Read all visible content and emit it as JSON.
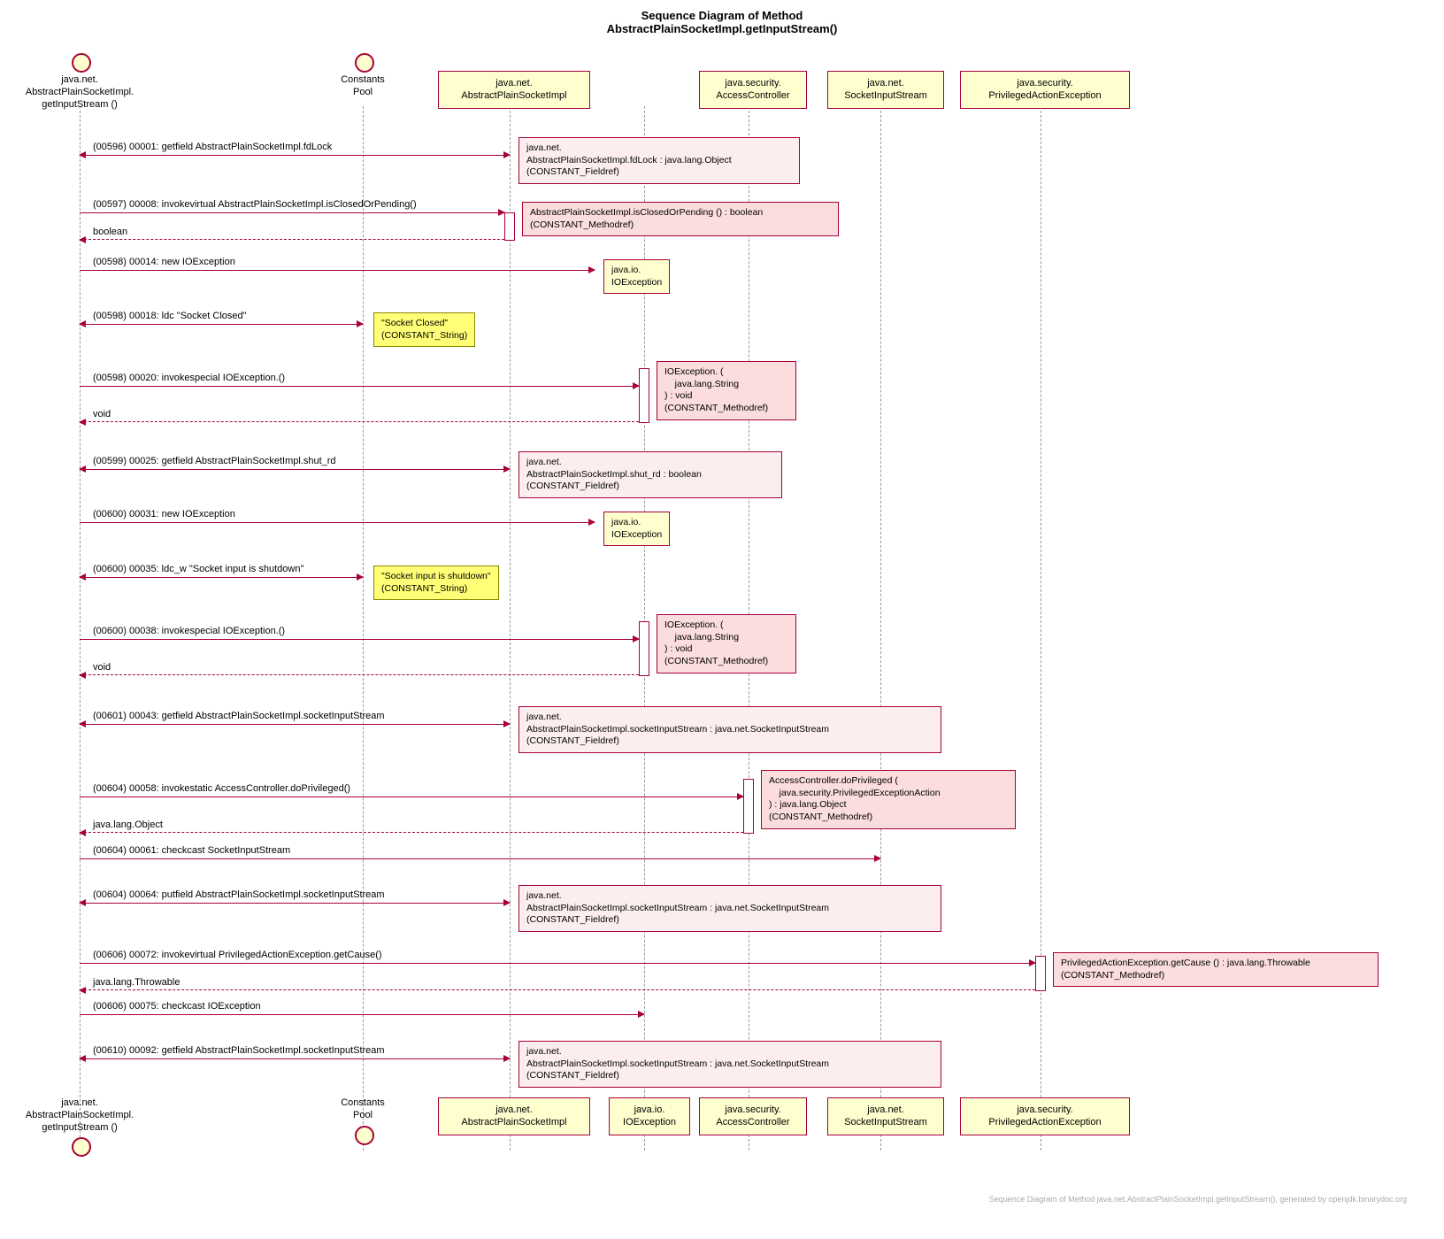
{
  "title": {
    "line1": "Sequence Diagram of Method",
    "line2": "AbstractPlainSocketImpl.getInputStream()"
  },
  "participants": {
    "p1": "java.net.\nAbstractPlainSocketImpl.\ngetInputStream ()",
    "p2": "Constants\nPool",
    "p3": "java.net.\nAbstractPlainSocketImpl",
    "p4": "java.io.\nIOException",
    "p5": "java.security.\nAccessController",
    "p6": "java.net.\nSocketInputStream",
    "p7": "java.security.\nPrivilegedActionException"
  },
  "messages": {
    "m1": "(00596) 00001: getfield AbstractPlainSocketImpl.fdLock",
    "m2": "(00597) 00008: invokevirtual AbstractPlainSocketImpl.isClosedOrPending()",
    "m2r": "boolean",
    "m3": "(00598) 00014: new IOException",
    "m4": "(00598) 00018: ldc \"Socket Closed\"",
    "m5": "(00598) 00020: invokespecial IOException.<init>()",
    "m5r": "void",
    "m6": "(00599) 00025: getfield AbstractPlainSocketImpl.shut_rd",
    "m7": "(00600) 00031: new IOException",
    "m8": "(00600) 00035: ldc_w \"Socket input is shutdown\"",
    "m9": "(00600) 00038: invokespecial IOException.<init>()",
    "m9r": "void",
    "m10": "(00601) 00043: getfield AbstractPlainSocketImpl.socketInputStream",
    "m11": "(00604) 00058: invokestatic AccessController.doPrivileged()",
    "m11r": "java.lang.Object",
    "m12": "(00604) 00061: checkcast SocketInputStream",
    "m13": "(00604) 00064: putfield AbstractPlainSocketImpl.socketInputStream",
    "m14": "(00606) 00072: invokevirtual PrivilegedActionException.getCause()",
    "m14r": "java.lang.Throwable",
    "m15": "(00606) 00075: checkcast IOException",
    "m16": "(00610) 00092: getfield AbstractPlainSocketImpl.socketInputStream"
  },
  "notes": {
    "n1": "java.net.\nAbstractPlainSocketImpl.fdLock : java.lang.Object\n(CONSTANT_Fieldref)",
    "n2": "AbstractPlainSocketImpl.isClosedOrPending () : boolean\n(CONSTANT_Methodref)",
    "n3": "java.io.\nIOException",
    "n4": "\"Socket Closed\"\n(CONSTANT_String)",
    "n5": "IOException.<init> (\n    java.lang.String\n) : void\n(CONSTANT_Methodref)",
    "n6": "java.net.\nAbstractPlainSocketImpl.shut_rd : boolean\n(CONSTANT_Fieldref)",
    "n7": "java.io.\nIOException",
    "n8": "\"Socket input is shutdown\"\n(CONSTANT_String)",
    "n9": "IOException.<init> (\n    java.lang.String\n) : void\n(CONSTANT_Methodref)",
    "n10": "java.net.\nAbstractPlainSocketImpl.socketInputStream : java.net.SocketInputStream\n(CONSTANT_Fieldref)",
    "n11": "AccessController.doPrivileged (\n    java.security.PrivilegedExceptionAction\n) : java.lang.Object\n(CONSTANT_Methodref)",
    "n12": "java.net.\nAbstractPlainSocketImpl.socketInputStream : java.net.SocketInputStream\n(CONSTANT_Fieldref)",
    "n13": "PrivilegedActionException.getCause () : java.lang.Throwable\n(CONSTANT_Methodref)",
    "n14": "java.net.\nAbstractPlainSocketImpl.socketInputStream : java.net.SocketInputStream\n(CONSTANT_Fieldref)"
  },
  "footer": "Sequence Diagram of Method java.net.AbstractPlainSocketImpl.getInputStream(),  generated by openjdk.binarydoc.org"
}
